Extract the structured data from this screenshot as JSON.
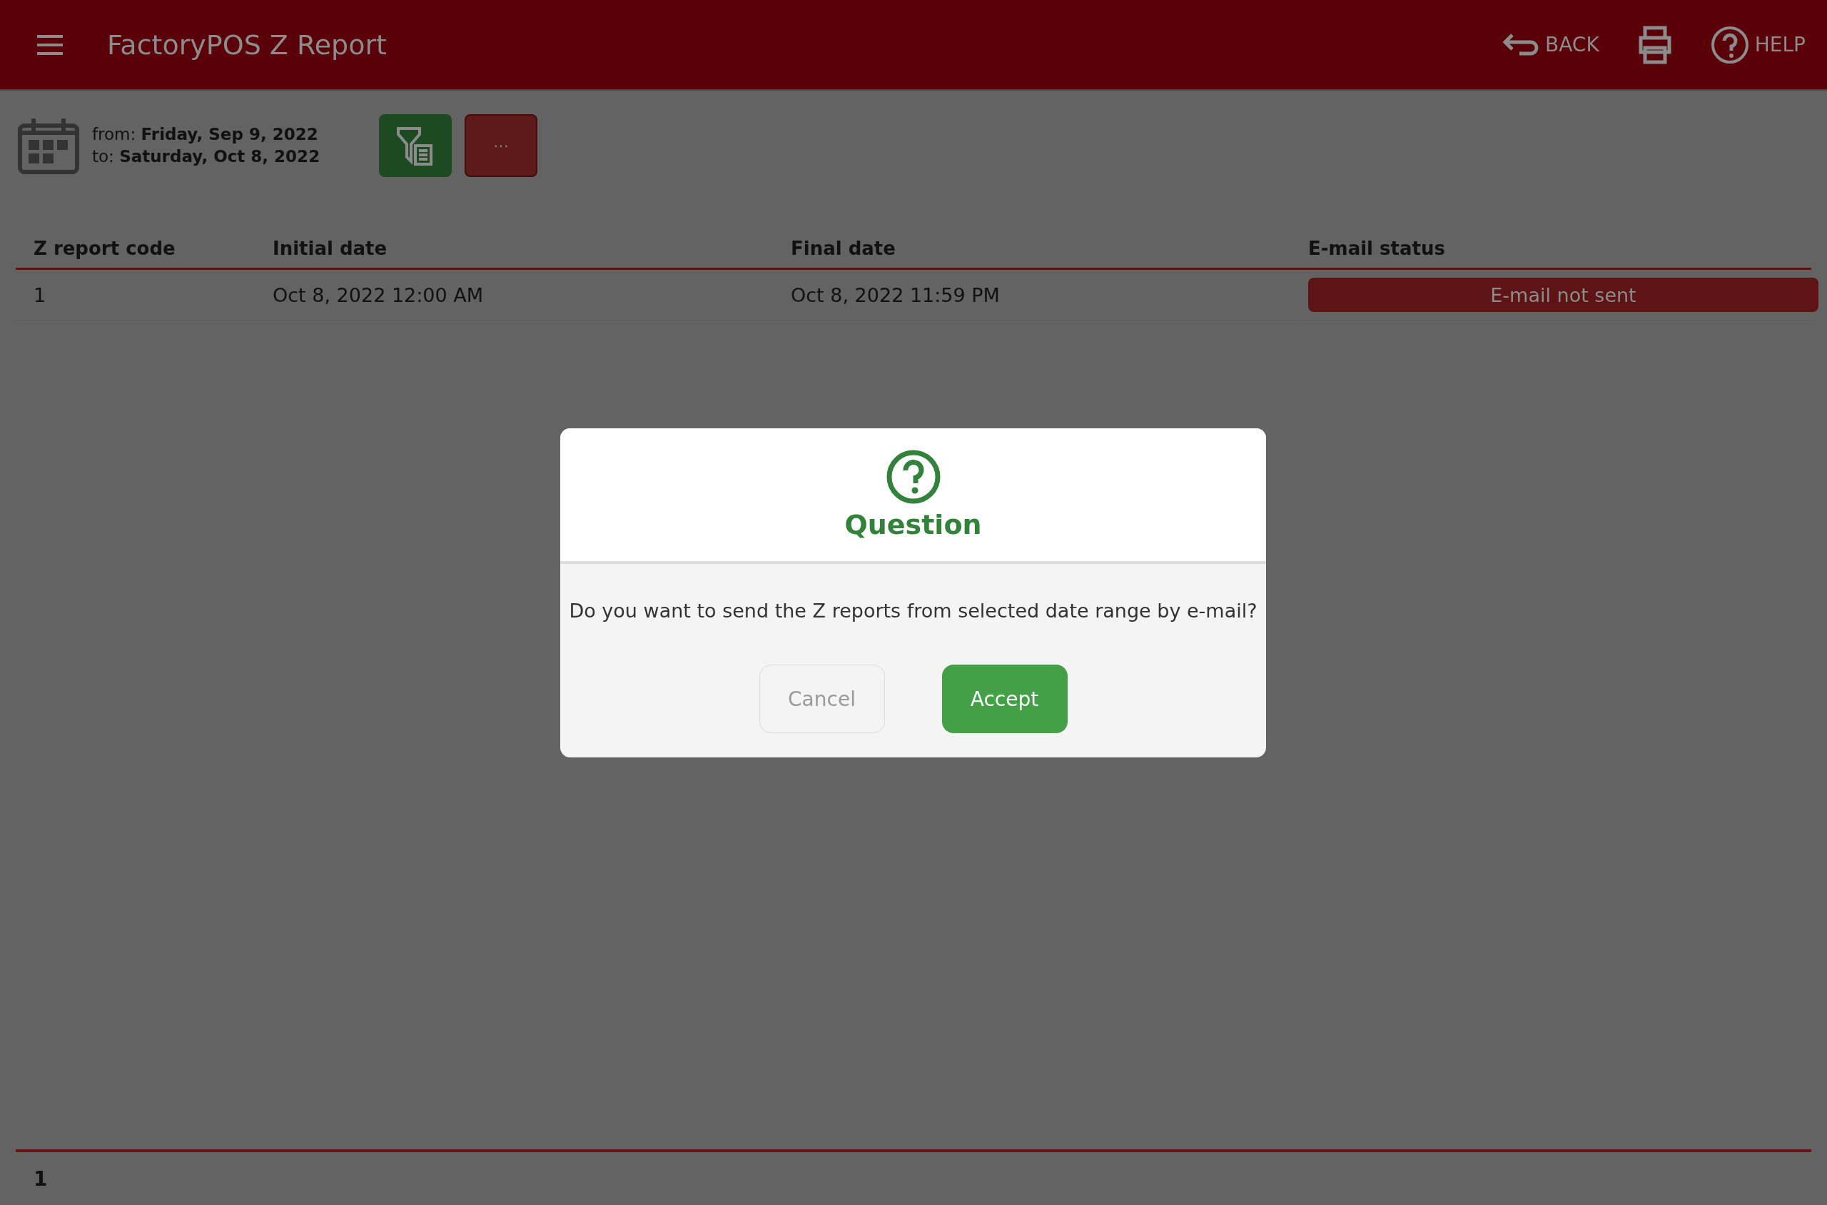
{
  "header": {
    "title": "FactoryPOS Z Report",
    "actions": [
      {
        "kind": "back",
        "label": "BACK"
      },
      {
        "kind": "print"
      },
      {
        "kind": "help",
        "label": "HELP"
      }
    ]
  },
  "date_range": {
    "from_label": "from:",
    "from": "Friday, Sep 9, 2022",
    "to_label": "to:",
    "to": "Saturday, Oct 8, 2022"
  },
  "toolbar_buttons": [
    {
      "kind": "filter"
    },
    {
      "kind": "more",
      "label": "···"
    }
  ],
  "table": {
    "columns": [
      "Z report code",
      "Initial date",
      "Final date",
      "E-mail status"
    ],
    "rows": [
      {
        "code": "1",
        "initial": "Oct 8, 2022 12:00 AM",
        "final": "Oct 8, 2022 11:59 PM",
        "status": "E-mail not sent",
        "sent": false
      }
    ]
  },
  "footer": {
    "count": "1"
  },
  "dialog": {
    "title": "Question",
    "message": "Do you want to send the Z reports from selected date range by e-mail?",
    "buttons": [
      {
        "label": "Cancel",
        "primary": false
      },
      {
        "label": "Accept",
        "primary": true
      }
    ]
  }
}
